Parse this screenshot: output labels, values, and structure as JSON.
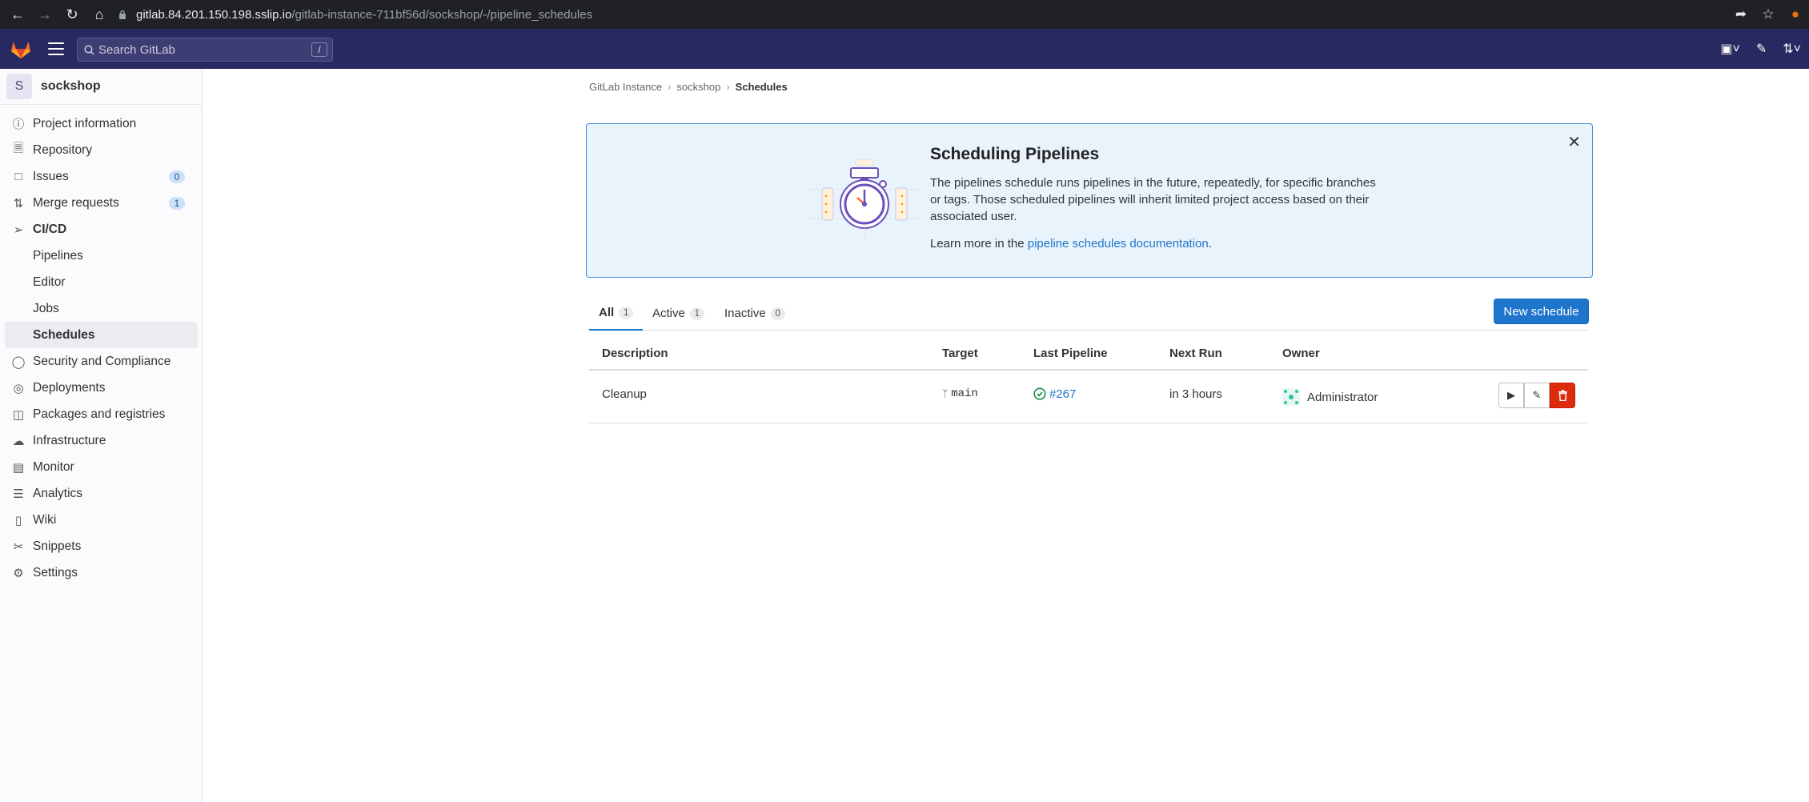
{
  "browser": {
    "url_host": "gitlab.84.201.150.198.sslip.io",
    "url_path": "/gitlab-instance-711bf56d/sockshop/-/pipeline_schedules"
  },
  "topbar": {
    "search_placeholder": "Search GitLab",
    "search_shortcut": "/"
  },
  "sidebar": {
    "project_initial": "S",
    "project_name": "sockshop",
    "items": [
      {
        "label": "Project information",
        "icon": "info-icon"
      },
      {
        "label": "Repository",
        "icon": "repository-icon"
      },
      {
        "label": "Issues",
        "icon": "issues-icon",
        "count": "0"
      },
      {
        "label": "Merge requests",
        "icon": "merge-request-icon",
        "count": "1"
      },
      {
        "label": "CI/CD",
        "icon": "rocket-icon"
      },
      {
        "label": "Pipelines"
      },
      {
        "label": "Editor"
      },
      {
        "label": "Jobs"
      },
      {
        "label": "Schedules"
      },
      {
        "label": "Security and Compliance",
        "icon": "shield-icon"
      },
      {
        "label": "Deployments",
        "icon": "deployments-icon"
      },
      {
        "label": "Packages and registries",
        "icon": "package-icon"
      },
      {
        "label": "Infrastructure",
        "icon": "cloud-icon"
      },
      {
        "label": "Monitor",
        "icon": "monitor-icon"
      },
      {
        "label": "Analytics",
        "icon": "chart-icon"
      },
      {
        "label": "Wiki",
        "icon": "book-icon"
      },
      {
        "label": "Snippets",
        "icon": "snippet-icon"
      },
      {
        "label": "Settings",
        "icon": "settings-icon"
      }
    ]
  },
  "breadcrumb": {
    "items": [
      "GitLab Instance",
      "sockshop",
      "Schedules"
    ]
  },
  "banner": {
    "title": "Scheduling Pipelines",
    "description": "The pipelines schedule runs pipelines in the future, repeatedly, for specific branches or tags. Those scheduled pipelines will inherit limited project access based on their associated user.",
    "learn_prefix": "Learn more in the ",
    "learn_link": "pipeline schedules documentation",
    "learn_suffix": "."
  },
  "tabs": [
    {
      "label": "All",
      "count": "1"
    },
    {
      "label": "Active",
      "count": "1"
    },
    {
      "label": "Inactive",
      "count": "0"
    }
  ],
  "new_schedule_label": "New schedule",
  "table": {
    "headers": [
      "Description",
      "Target",
      "Last Pipeline",
      "Next Run",
      "Owner"
    ],
    "rows": [
      {
        "description": "Cleanup",
        "target": "main",
        "last_pipeline": "#267",
        "next_run": "in 3 hours",
        "owner": "Administrator"
      }
    ]
  },
  "colors": {
    "topbar": "#292961",
    "primary": "#1f75cb",
    "danger": "#dd2b0e",
    "success": "#108548"
  }
}
